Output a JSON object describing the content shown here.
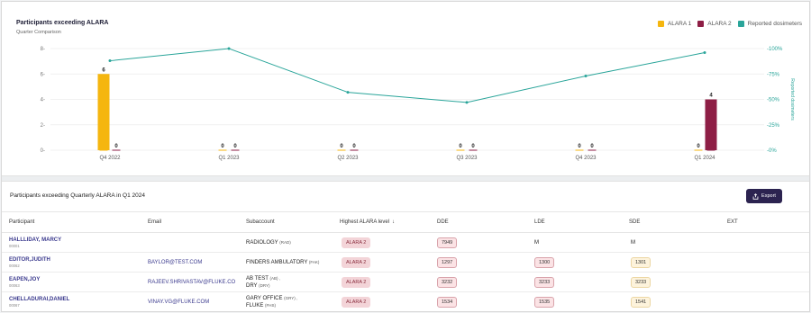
{
  "chart": {
    "title": "Participants exceeding ALARA",
    "subtitle": "Quarter Comparison",
    "legend": [
      {
        "label": "ALARA 1",
        "color": "#f5b60f"
      },
      {
        "label": "ALARA 2",
        "color": "#8e1e45"
      },
      {
        "label": "Reported dosimeters",
        "color": "#2aa59a"
      }
    ],
    "right_axis_label": "Reported dosimeters"
  },
  "chart_data": {
    "type": "bar",
    "categories": [
      "Q4 2022",
      "Q1 2023",
      "Q2 2023",
      "Q3 2023",
      "Q4 2023",
      "Q1 2024"
    ],
    "series": [
      {
        "name": "ALARA 1",
        "values": [
          6,
          0,
          0,
          0,
          0,
          0
        ],
        "color": "#f5b60f",
        "axis": "left"
      },
      {
        "name": "ALARA 2",
        "values": [
          0,
          0,
          0,
          0,
          0,
          4
        ],
        "color": "#8e1e45",
        "axis": "left"
      },
      {
        "name": "Reported dosimeters",
        "type": "line",
        "values": [
          88,
          100,
          57,
          47,
          73,
          96
        ],
        "color": "#2aa59a",
        "axis": "right"
      }
    ],
    "y_left": {
      "ticks": [
        "0",
        "2",
        "4",
        "6",
        "8"
      ],
      "lim": [
        0,
        8
      ]
    },
    "y_right": {
      "ticks": [
        "0%",
        "25%",
        "50%",
        "75%",
        "100%"
      ],
      "lim": [
        0,
        100
      ],
      "label": "Reported dosimeters"
    },
    "grid": true,
    "legend_position": "top-right"
  },
  "table": {
    "title": "Participants exceeding Quarterly ALARA in Q1 2024",
    "export_label": "Export",
    "columns": [
      "Participant",
      "Email",
      "Subaccount",
      "Highest ALARA level",
      "DDE",
      "LDE",
      "SDE",
      "EXT"
    ],
    "rows": [
      {
        "name": "HALLLIDAY, MARCY",
        "id": "00001",
        "email": "",
        "sub": [
          {
            "name": "RADIOLOGY",
            "code": "(RAD)"
          }
        ],
        "alara": "ALARA 2",
        "dde": "7949",
        "lde": "M",
        "sde": "M"
      },
      {
        "name": "EDITOR,JUDITH",
        "id": "00062",
        "email": "BAYLOR@TEST.COM",
        "sub": [
          {
            "name": "FINDERS AMBULATORY",
            "code": "(FAK)"
          }
        ],
        "alara": "ALARA 2",
        "dde": "1297",
        "lde": "1300",
        "sde": "1301"
      },
      {
        "name": "EAPEN,JOY",
        "id": "00063",
        "email": "RAJEEV.SHRIVASTAV@FLUKE.CO",
        "sub": [
          {
            "name": "AB TEST",
            "code": "(AB) ,"
          },
          {
            "name": "DRY",
            "code": "(DRY)"
          }
        ],
        "alara": "ALARA 2",
        "dde": "3232",
        "lde": "3233",
        "sde": "3233"
      },
      {
        "name": "CHELLADURAI,DANIEL",
        "id": "00067",
        "email": "VINAY.VG@FLUKE.COM",
        "sub": [
          {
            "name": "GARY OFFICE",
            "code": "(GRY) ,"
          },
          {
            "name": "FLUKE",
            "code": "(FHS)"
          }
        ],
        "alara": "ALARA 2",
        "dde": "1534",
        "lde": "1535",
        "sde": "1541"
      }
    ]
  }
}
